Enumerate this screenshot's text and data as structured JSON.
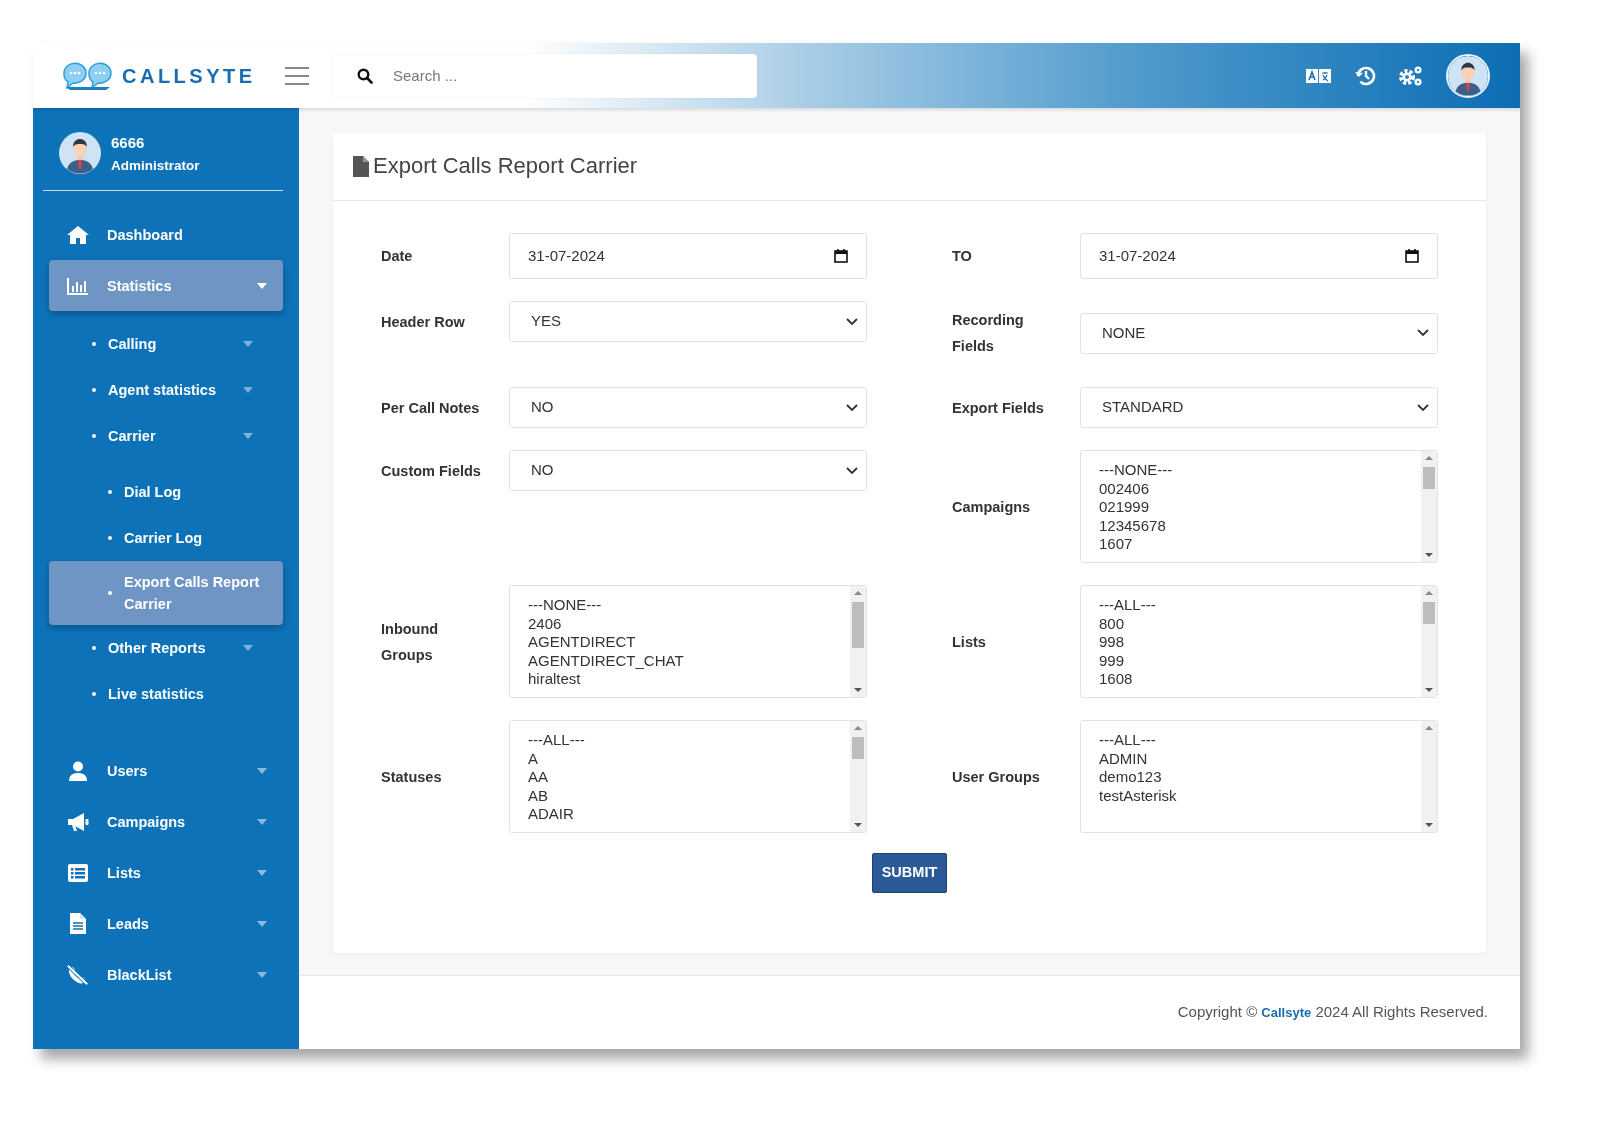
{
  "header": {
    "logo_text": "CALLSYTE",
    "search_placeholder": "Search ..."
  },
  "user": {
    "name": "6666",
    "role": "Administrator"
  },
  "sidebar": {
    "items": [
      {
        "label": "Dashboard",
        "selected": false,
        "submenu": false
      },
      {
        "label": "Statistics",
        "selected": true,
        "submenu": true,
        "expanded": true,
        "children": [
          {
            "label": "Calling",
            "selected": false,
            "submenu": true,
            "expanded": false
          },
          {
            "label": "Agent statistics",
            "selected": false,
            "submenu": true,
            "expanded": false
          },
          {
            "label": "Carrier",
            "selected": false,
            "submenu": true,
            "expanded": true,
            "children": [
              {
                "label": "Dial Log",
                "selected": false,
                "submenu": false
              },
              {
                "label": "Carrier Log",
                "selected": false,
                "submenu": false
              },
              {
                "label": "Export Calls Report Carrier",
                "selected": true,
                "submenu": false
              }
            ]
          },
          {
            "label": "Other Reports",
            "selected": false,
            "submenu": true,
            "expanded": false
          },
          {
            "label": "Live statistics",
            "selected": false,
            "submenu": false
          }
        ]
      },
      {
        "label": "Users",
        "selected": false,
        "submenu": true,
        "expanded": false
      },
      {
        "label": "Campaigns",
        "selected": false,
        "submenu": true,
        "expanded": false
      },
      {
        "label": "Lists",
        "selected": false,
        "submenu": true,
        "expanded": false
      },
      {
        "label": "Leads",
        "selected": false,
        "submenu": true,
        "expanded": false
      },
      {
        "label": "BlackList",
        "selected": false,
        "submenu": true,
        "expanded": false
      }
    ]
  },
  "page": {
    "title": "Export Calls Report Carrier",
    "fields": [
      {
        "kind": "date",
        "label": "Date",
        "value": "31-07-2024"
      },
      {
        "kind": "date",
        "label": "TO",
        "value": "31-07-2024"
      },
      {
        "kind": "select",
        "label": "Header Row",
        "value": "YES"
      },
      {
        "kind": "select",
        "label": "Recording Fields",
        "value": "NONE"
      },
      {
        "kind": "select",
        "label": "Per Call Notes",
        "value": "NO"
      },
      {
        "kind": "select",
        "label": "Export Fields",
        "value": "STANDARD"
      },
      {
        "kind": "select",
        "label": "Custom Fields",
        "value": "NO"
      },
      {
        "kind": "listbox",
        "label": "Campaigns",
        "options": [
          "---NONE---",
          "002406",
          "021999",
          "12345678",
          "1607"
        ]
      },
      {
        "kind": "listbox",
        "label": "Inbound Groups",
        "options": [
          "---NONE---",
          "2406",
          "AGENTDIRECT",
          "AGENTDIRECT_CHAT",
          "hiraltest"
        ]
      },
      {
        "kind": "listbox",
        "label": "Lists",
        "options": [
          "---ALL---",
          "800",
          "998",
          "999",
          "1608"
        ]
      },
      {
        "kind": "listbox",
        "label": "Statuses",
        "options": [
          "---ALL---",
          "A",
          "AA",
          "AB",
          "ADAIR"
        ]
      },
      {
        "kind": "listbox",
        "label": "User Groups",
        "options": [
          "---ALL---",
          "ADMIN",
          "demo123",
          "testAsterisk"
        ]
      }
    ],
    "submit": "SUBMIT"
  },
  "footer": {
    "copyright": "Copyright ©",
    "brand": "Callsyte",
    "rights": "2024 All Rights Reserved."
  }
}
